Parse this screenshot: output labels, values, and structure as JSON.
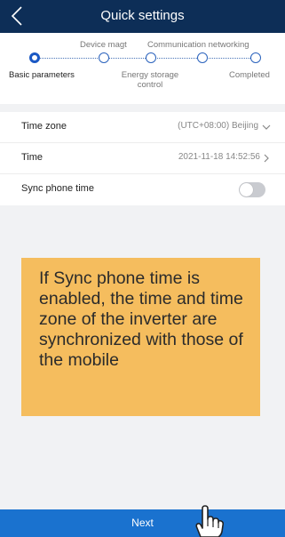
{
  "header": {
    "title": "Quick settings"
  },
  "steps": [
    {
      "label": "Basic parameters",
      "position": "bottom",
      "active": true
    },
    {
      "label": "Device magt",
      "position": "top",
      "active": false
    },
    {
      "label": "Energy storage\ncontrol",
      "position": "bottom",
      "active": false
    },
    {
      "label": "Communication networking",
      "position": "top",
      "active": false
    },
    {
      "label": "Completed",
      "position": "bottom",
      "active": false
    }
  ],
  "settings": {
    "time_zone": {
      "label": "Time zone",
      "value": "(UTC+08:00) Beijing"
    },
    "time": {
      "label": "Time",
      "value": "2021-11-18 14:52:56"
    },
    "sync": {
      "label": "Sync phone time",
      "enabled": false
    }
  },
  "callout": {
    "text": "If Sync phone time is enabled, the time and time zone of the inverter are synchronized with those of the mobile"
  },
  "footer": {
    "next_label": "Next"
  },
  "colors": {
    "header": "#0d2e57",
    "accent": "#1a72cf",
    "callout": "#f5bd5e"
  }
}
